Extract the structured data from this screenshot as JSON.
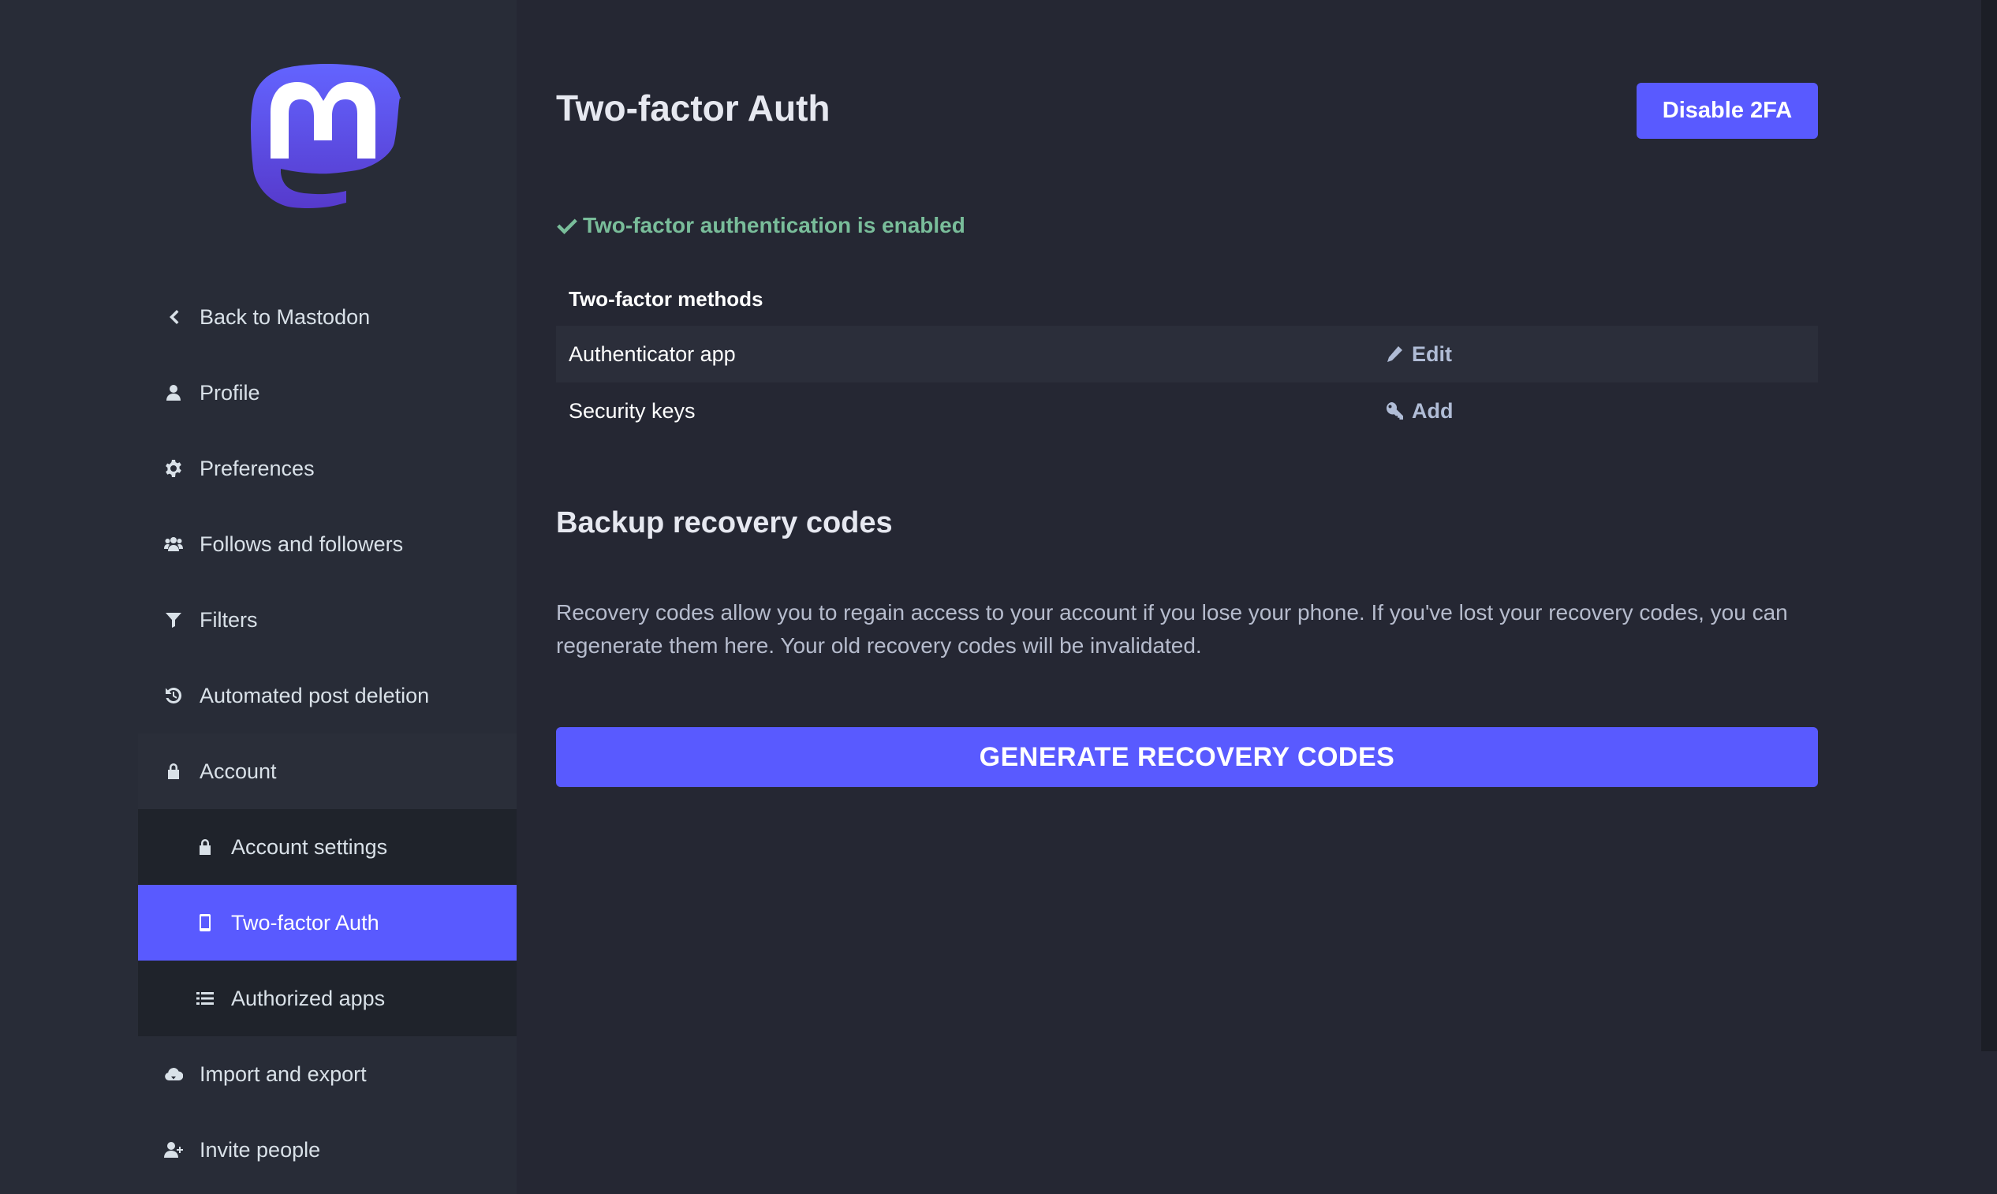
{
  "sidebar": {
    "items": [
      {
        "label": "Back to Mastodon",
        "icon": "chevron-left-icon"
      },
      {
        "label": "Profile",
        "icon": "user-icon"
      },
      {
        "label": "Preferences",
        "icon": "gear-icon"
      },
      {
        "label": "Follows and followers",
        "icon": "users-icon"
      },
      {
        "label": "Filters",
        "icon": "filter-icon"
      },
      {
        "label": "Automated post deletion",
        "icon": "history-icon"
      },
      {
        "label": "Account",
        "icon": "lock-icon"
      }
    ],
    "sub_items": [
      {
        "label": "Account settings",
        "icon": "lock-icon"
      },
      {
        "label": "Two-factor Auth",
        "icon": "mobile-icon",
        "active": true
      },
      {
        "label": "Authorized apps",
        "icon": "list-icon"
      }
    ],
    "items_after": [
      {
        "label": "Import and export",
        "icon": "cloud-download-icon"
      },
      {
        "label": "Invite people",
        "icon": "user-plus-icon"
      }
    ]
  },
  "main": {
    "title": "Two-factor Auth",
    "disable_button": "Disable 2FA",
    "status": "Two-factor authentication is enabled",
    "methods_header": "Two-factor methods",
    "methods": [
      {
        "name": "Authenticator app",
        "action": "Edit",
        "icon": "pencil-icon"
      },
      {
        "name": "Security keys",
        "action": "Add",
        "icon": "key-icon"
      }
    ],
    "backup_title": "Backup recovery codes",
    "backup_desc": "Recovery codes allow you to regain access to your account if you lose your phone. If you've lost your recovery codes, you can regenerate them here. Your old recovery codes will be invalidated.",
    "generate_button": "GENERATE RECOVERY CODES"
  },
  "colors": {
    "accent": "#595aff",
    "success": "#79bd9a",
    "background": "#252733",
    "sidebar": "#282c37"
  }
}
